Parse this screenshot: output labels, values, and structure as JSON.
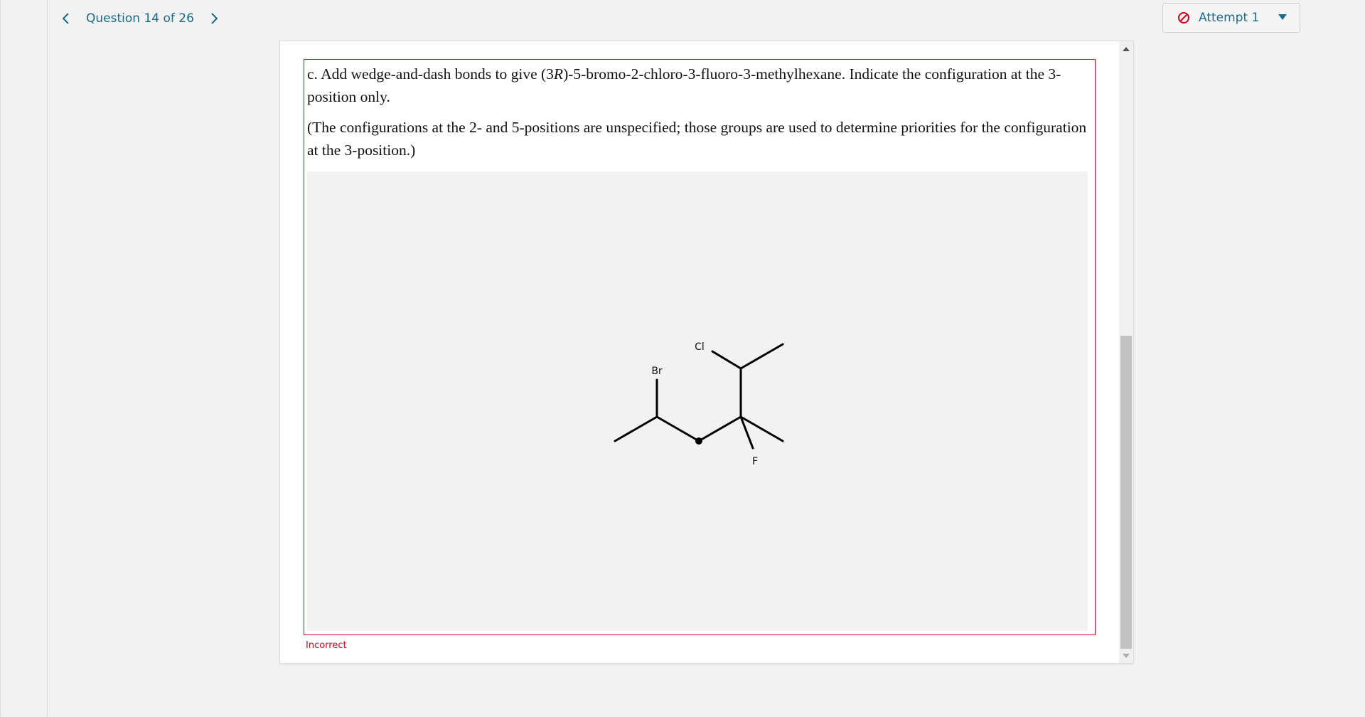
{
  "nav": {
    "question_label": "Question 14 of 26",
    "prev_icon": "chevron-left-icon",
    "next_icon": "chevron-right-icon"
  },
  "attempt": {
    "label": "Attempt 1",
    "icon": "no-entry-icon",
    "dropdown_icon": "caret-down-icon"
  },
  "question": {
    "paragraph1_prefix": "c. Add wedge-and-dash bonds to give (3",
    "paragraph1_italic": "R",
    "paragraph1_suffix": ")-5-bromo-2-chloro-3-fluoro-3-methylhexane. Indicate the configuration at the 3-position only.",
    "paragraph2": "(The configurations at the 2- and 5-positions are unspecified; those groups are used to determine priorities for the configuration at the 3-position.)"
  },
  "molecule": {
    "atom_labels": {
      "br": "Br",
      "cl": "Cl",
      "f": "F"
    }
  },
  "feedback": {
    "status": "Incorrect"
  },
  "colors": {
    "accent": "#1a6b8a",
    "error": "#d0021b",
    "canvas_bg": "#f2f2f2"
  }
}
